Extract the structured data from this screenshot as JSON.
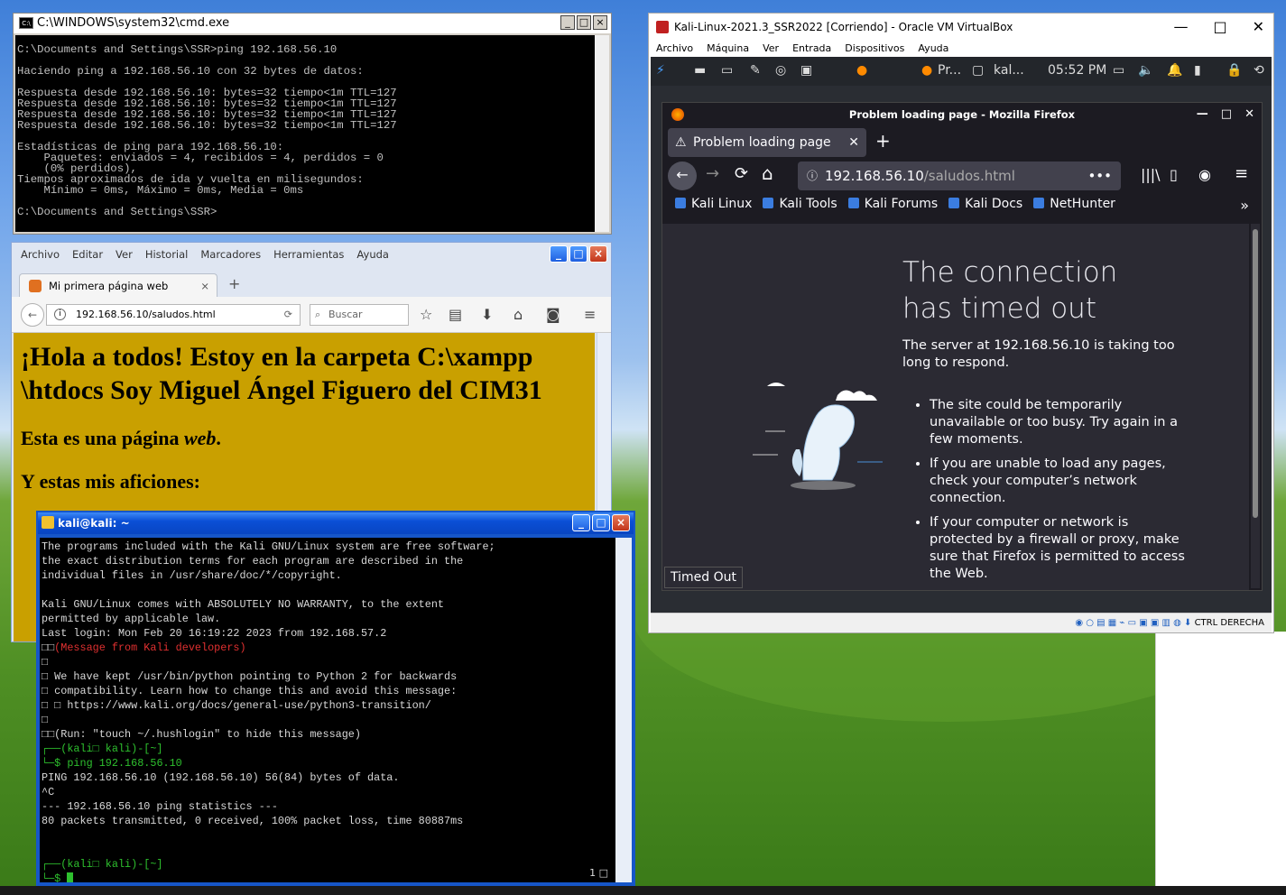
{
  "cmd": {
    "title": "C:\\WINDOWS\\system32\\cmd.exe",
    "output": "C:\\Documents and Settings\\SSR>ping 192.168.56.10\n\nHaciendo ping a 192.168.56.10 con 32 bytes de datos:\n\nRespuesta desde 192.168.56.10: bytes=32 tiempo<1m TTL=127\nRespuesta desde 192.168.56.10: bytes=32 tiempo<1m TTL=127\nRespuesta desde 192.168.56.10: bytes=32 tiempo<1m TTL=127\nRespuesta desde 192.168.56.10: bytes=32 tiempo<1m TTL=127\n\nEstadísticas de ping para 192.168.56.10:\n    Paquetes: enviados = 4, recibidos = 4, perdidos = 0\n    (0% perdidos),\nTiempos aproximados de ida y vuelta en milisegundos:\n    Mínimo = 0ms, Máximo = 0ms, Media = 0ms\n\nC:\\Documents and Settings\\SSR>"
  },
  "xp_firefox": {
    "menu": [
      "Archivo",
      "Editar",
      "Ver",
      "Historial",
      "Marcadores",
      "Herramientas",
      "Ayuda"
    ],
    "tab_title": "Mi primera página web",
    "url_host": "192.168.56.10",
    "url_path": "/saludos.html",
    "search_placeholder": "Buscar",
    "heading": "¡Hola a todos! Estoy en la carpeta C:\\xampp \\htdocs Soy Miguel Ángel Figuero del CIM31",
    "line1_prefix": "Esta es una página ",
    "line1_em": "web",
    "line1_suffix": ".",
    "line2": "Y estas mis aficiones:"
  },
  "terminal": {
    "title": "kali@kali: ~",
    "line_a": "The programs included with the Kali GNU/Linux system are free software;\nthe exact distribution terms for each program are described in the\nindividual files in /usr/share/doc/*/copyright.\n\nKali GNU/Linux comes with ABSOLUTELY NO WARRANTY, to the extent\npermitted by applicable law.\nLast login: Mon Feb 20 16:19:22 2023 from 192.168.57.2",
    "msg_prefix": "□□",
    "msg_red": "(Message from Kali developers)",
    "line_b": "□\n□ We have kept /usr/bin/python pointing to Python 2 for backwards\n□ compatibility. Learn how to change this and avoid this message:\n□ □ https://www.kali.org/docs/general-use/python3-transition/\n□\n□□(Run: \"touch ~/.hushlogin\" to hide this message)",
    "prompt1": "┌──(kali□ kali)-[~]",
    "cmd_prefix": "└─$ ",
    "cmd": "ping 192.168.56.10",
    "ping_out": "PING 192.168.56.10 (192.168.56.10) 56(84) bytes of data.\n^C\n--- 192.168.56.10 ping statistics ---\n80 packets transmitted, 0 received, 100% packet loss, time 80887ms",
    "prompt2": "┌──(kali□ kali)-[~]",
    "prompt2b": "└─$ ",
    "counter": "1 □"
  },
  "vbox": {
    "title": "Kali-Linux-2021.3_SSR2022 [Corriendo] - Oracle VM VirtualBox",
    "menu": [
      "Archivo",
      "Máquina",
      "Ver",
      "Entrada",
      "Dispositivos",
      "Ayuda"
    ],
    "panel_pr": "Pr...",
    "panel_kal": "kal...",
    "clock": "05:52 PM",
    "status_right": "CTRL DERECHA"
  },
  "kali_firefox": {
    "window_title": "Problem loading page - Mozilla Firefox",
    "tab_title": "Problem loading page",
    "url_host": "192.168.56.10",
    "url_path": "/saludos.html",
    "bookmarks": [
      "Kali Linux",
      "Kali Tools",
      "Kali Forums",
      "Kali Docs",
      "NetHunter"
    ],
    "error_title": "The connection has timed out",
    "error_desc": "The server at 192.168.56.10 is taking too long to respond.",
    "bullets": [
      "The site could be temporarily unavailable or too busy. Try again in a few moments.",
      "If you are unable to load any pages, check your computer’s network connection.",
      "If your computer or network is protected by a firewall or proxy, make sure that Firefox is permitted to access the Web."
    ],
    "status": "Timed Out"
  }
}
